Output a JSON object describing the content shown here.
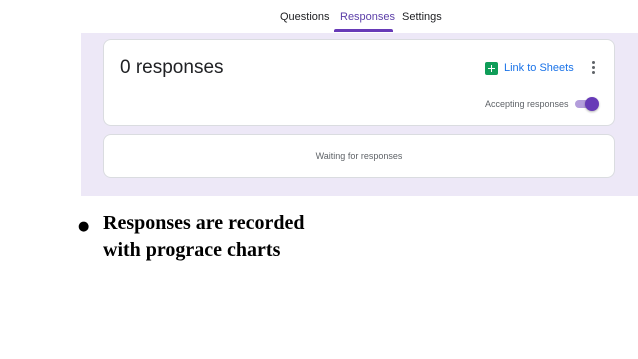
{
  "tabs": [
    {
      "label": "Questions",
      "active": false
    },
    {
      "label": "Responses",
      "active": true
    },
    {
      "label": "Settings",
      "active": false
    }
  ],
  "summary": {
    "count_label": "0 responses",
    "sheets_link_label": "Link to Sheets",
    "sheets_icon": "google-sheets-icon",
    "more_icon": "more-vert-icon",
    "accepting_label": "Accepting responses",
    "accepting_on": true
  },
  "waiting": {
    "text": "Waiting for responses"
  },
  "slide": {
    "bullet": "●",
    "line1": "Responses are recorded",
    "line2": "with prograce charts"
  },
  "colors": {
    "accent": "#673ab7",
    "forms_background": "#ede8f7",
    "link": "#1a73e8",
    "sheets_green": "#0f9d58"
  }
}
